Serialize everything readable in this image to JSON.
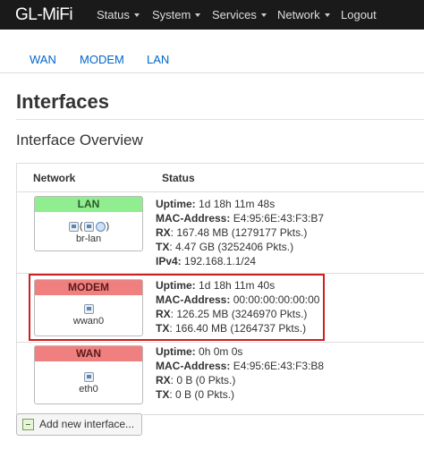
{
  "navbar": {
    "brand": "GL-MiFi",
    "menus": [
      "Status",
      "System",
      "Services",
      "Network"
    ],
    "logout": "Logout"
  },
  "tabs": [
    "WAN",
    "MODEM",
    "LAN"
  ],
  "page_title": "Interfaces",
  "section_title": "Interface Overview",
  "table": {
    "headers": [
      "Network",
      "Status"
    ],
    "rows": [
      {
        "name": "LAN",
        "device": "br-lan",
        "head_color": "#90ee90",
        "icons": [
          "bridge-icon",
          "ethernet-icon",
          "wireless-icon"
        ],
        "status": [
          {
            "label": "Uptime:",
            "value": "1d 18h 11m 48s"
          },
          {
            "label": "MAC-Address:",
            "value": "E4:95:6E:43:F3:B7"
          },
          {
            "label": "RX",
            "value": ": 167.48 MB (1279177 Pkts.)"
          },
          {
            "label": "TX",
            "value": ": 4.47 GB (3252406 Pkts.)"
          },
          {
            "label": "IPv4:",
            "value": "192.168.1.1/24"
          }
        ]
      },
      {
        "name": "MODEM",
        "device": "wwan0",
        "head_color": "#f08080",
        "icons": [
          "ethernet-icon"
        ],
        "status": [
          {
            "label": "Uptime:",
            "value": "1d 18h 11m 40s"
          },
          {
            "label": "MAC-Address:",
            "value": "00:00:00:00:00:00"
          },
          {
            "label": "RX",
            "value": ": 126.25 MB (3246970 Pkts.)"
          },
          {
            "label": "TX",
            "value": ": 166.40 MB (1264737 Pkts.)"
          }
        ]
      },
      {
        "name": "WAN",
        "device": "eth0",
        "head_color": "#f08080",
        "icons": [
          "ethernet-icon"
        ],
        "status": [
          {
            "label": "Uptime:",
            "value": "0h 0m 0s"
          },
          {
            "label": "MAC-Address:",
            "value": "E4:95:6E:43:F3:B8"
          },
          {
            "label": "RX",
            "value": ": 0 B (0 Pkts.)"
          },
          {
            "label": "TX",
            "value": ": 0 B (0 Pkts.)"
          }
        ]
      }
    ]
  },
  "add_button": "Add new interface...",
  "highlight_color": "#cc1f1f"
}
